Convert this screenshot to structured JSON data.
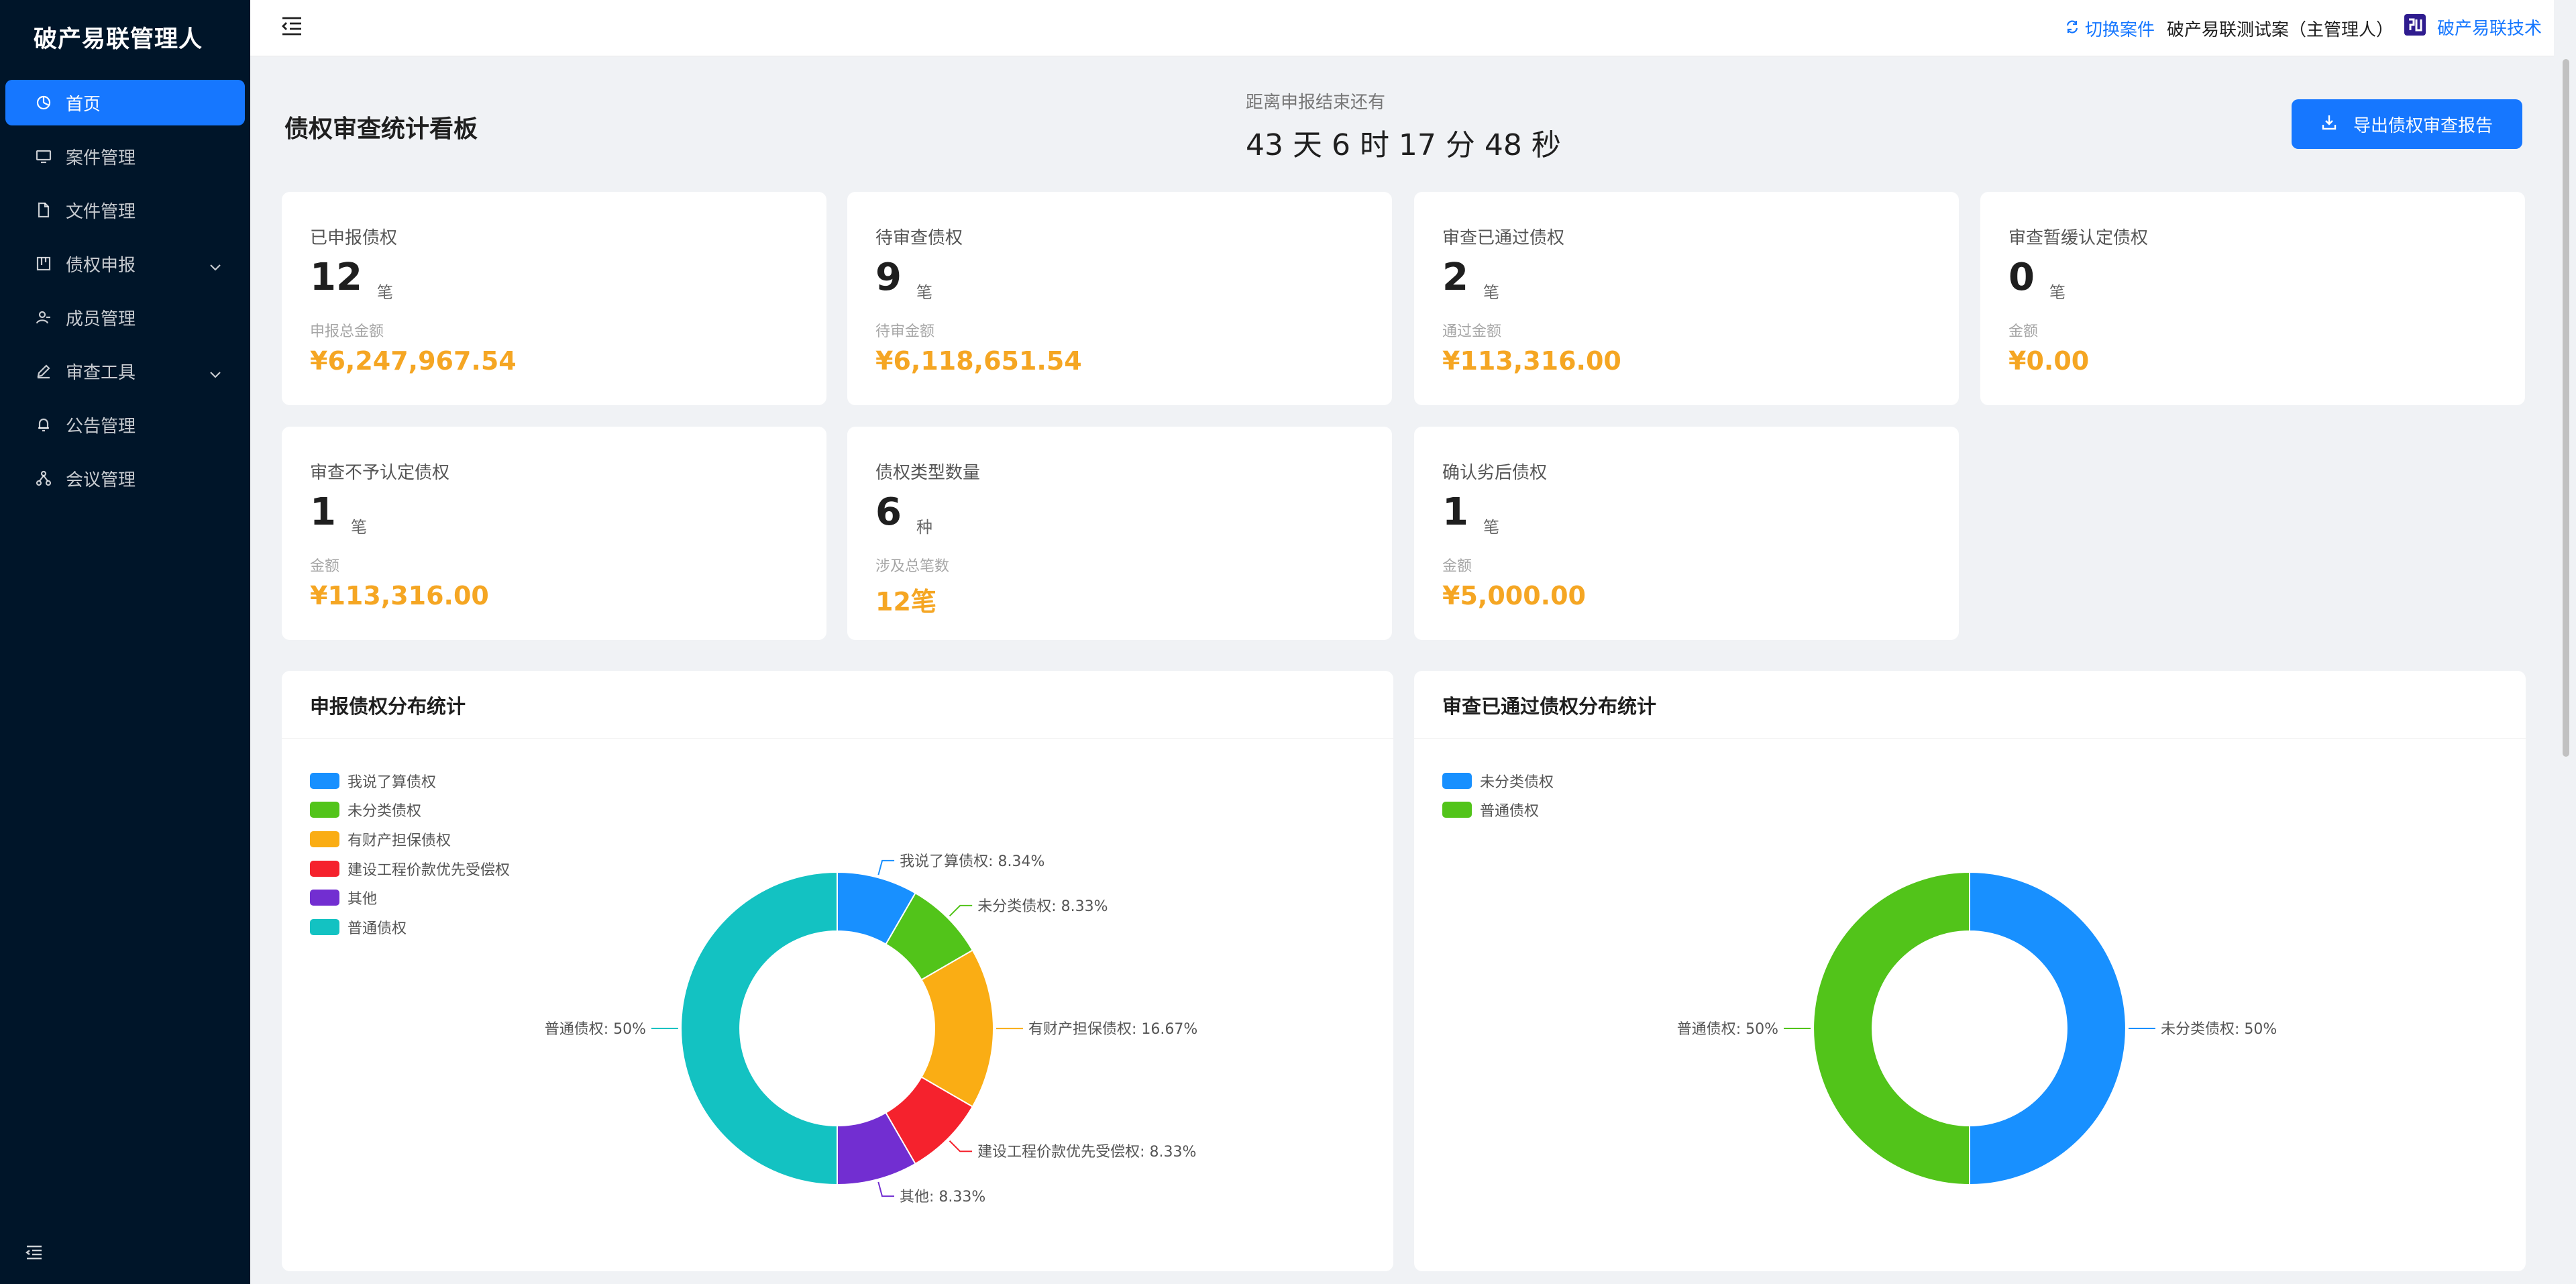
{
  "sidebar": {
    "brand": "破产易联管理人",
    "items": [
      {
        "label": "首页",
        "icon": "dashboard-icon",
        "active": true,
        "has_arrow": false
      },
      {
        "label": "案件管理",
        "icon": "monitor-icon",
        "active": false,
        "has_arrow": false
      },
      {
        "label": "文件管理",
        "icon": "file-icon",
        "active": false,
        "has_arrow": false
      },
      {
        "label": "债权申报",
        "icon": "board-icon",
        "active": false,
        "has_arrow": true
      },
      {
        "label": "成员管理",
        "icon": "user-icon",
        "active": false,
        "has_arrow": false
      },
      {
        "label": "审查工具",
        "icon": "pen-icon",
        "active": false,
        "has_arrow": true
      },
      {
        "label": "公告管理",
        "icon": "bell-icon",
        "active": false,
        "has_arrow": false
      },
      {
        "label": "会议管理",
        "icon": "cluster-icon",
        "active": false,
        "has_arrow": false
      }
    ]
  },
  "header": {
    "switch_case": "切换案件",
    "case_name": "破产易联测试案（主管理人）",
    "org_name": "破产易联技术"
  },
  "dashboard": {
    "title": "债权审查统计看板",
    "countdown_label": "距离申报结束还有",
    "countdown": "43 天 6 时 17 分 48 秒",
    "export_label": "导出债权审查报告"
  },
  "cards": [
    {
      "label": "已申报债权",
      "count": "12",
      "unit": "笔",
      "sub_label": "申报总金额",
      "amount": "¥6,247,967.54"
    },
    {
      "label": "待审查债权",
      "count": "9",
      "unit": "笔",
      "sub_label": "待审金额",
      "amount": "¥6,118,651.54"
    },
    {
      "label": "审查已通过债权",
      "count": "2",
      "unit": "笔",
      "sub_label": "通过金额",
      "amount": "¥113,316.00"
    },
    {
      "label": "审查暂缓认定债权",
      "count": "0",
      "unit": "笔",
      "sub_label": "金额",
      "amount": "¥0.00"
    },
    {
      "label": "审查不予认定债权",
      "count": "1",
      "unit": "笔",
      "sub_label": "金额",
      "amount": "¥113,316.00"
    },
    {
      "label": "债权类型数量",
      "count": "6",
      "unit": "种",
      "sub_label": "涉及总笔数",
      "amount": "12笔"
    },
    {
      "label": "确认劣后债权",
      "count": "1",
      "unit": "笔",
      "sub_label": "金额",
      "amount": "¥5,000.00"
    }
  ],
  "chart_data": [
    {
      "type": "pie",
      "title": "申报债权分布统计",
      "donut": true,
      "legend_position": "top-left",
      "slices": [
        {
          "name": "我说了算债权",
          "value": 8.34,
          "label": "我说了算债权: 8.34%",
          "color": "#1890ff"
        },
        {
          "name": "未分类债权",
          "value": 8.33,
          "label": "未分类债权: 8.33%",
          "color": "#52c41a"
        },
        {
          "name": "有财产担保债权",
          "value": 16.67,
          "label": "有财产担保债权: 16.67%",
          "color": "#faad14"
        },
        {
          "name": "建设工程价款优先受偿权",
          "value": 8.33,
          "label": "建设工程价款优先受偿权: 8.33%",
          "color": "#f5222d"
        },
        {
          "name": "其他",
          "value": 8.33,
          "label": "其他: 8.33%",
          "color": "#722ed1"
        },
        {
          "name": "普通债权",
          "value": 50,
          "label": "普通债权: 50%",
          "color": "#13c2c2"
        }
      ]
    },
    {
      "type": "pie",
      "title": "审查已通过债权分布统计",
      "donut": true,
      "legend_position": "top-left",
      "slices": [
        {
          "name": "未分类债权",
          "value": 50,
          "label": "未分类债权: 50%",
          "color": "#1890ff"
        },
        {
          "name": "普通债权",
          "value": 50,
          "label": "普通债权: 50%",
          "color": "#52c41a"
        }
      ]
    }
  ]
}
